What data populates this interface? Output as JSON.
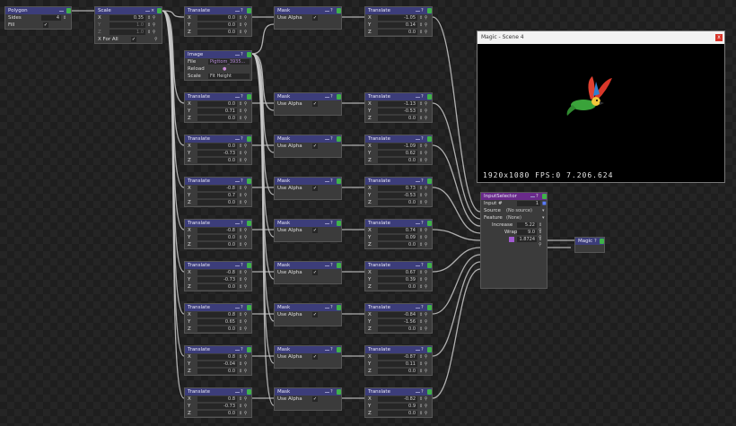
{
  "polygon": {
    "title": "Polygon",
    "sides_label": "Sides",
    "sides_value": "4",
    "fill_label": "Fill"
  },
  "scale": {
    "title": "Scale",
    "x": "0.35",
    "y": "1.0",
    "z": "1.0",
    "xforall": "X For All"
  },
  "image": {
    "title": "Image",
    "file_label": "File",
    "file_value": "Pigttom_3935...",
    "reload_label": "Reload",
    "scale_label": "Scale",
    "scale_value": "Fit Height"
  },
  "mask": {
    "title": "Mask",
    "use_alpha": "Use Alpha"
  },
  "translate_title": "Translate",
  "translate_left": [
    {
      "x": "0.0",
      "y": "0.0",
      "z": "0.0"
    },
    {
      "x": "0.0",
      "y": "0.71",
      "z": "0.0"
    },
    {
      "x": "0.0",
      "y": "-0.73",
      "z": "0.0"
    },
    {
      "x": "-0.8",
      "y": "0.7",
      "z": "0.0"
    },
    {
      "x": "-0.8",
      "y": "0.0",
      "z": "0.0"
    },
    {
      "x": "-0.8",
      "y": "-0.73",
      "z": "0.0"
    },
    {
      "x": "0.8",
      "y": "0.65",
      "z": "0.0"
    },
    {
      "x": "0.8",
      "y": "-0.04",
      "z": "0.0"
    },
    {
      "x": "0.8",
      "y": "-0.73",
      "z": "0.0"
    }
  ],
  "translate_right": [
    {
      "x": "-1.05",
      "y": "0.14",
      "z": "0.0"
    },
    {
      "x": "-1.13",
      "y": "-0.53",
      "z": "0.0"
    },
    {
      "x": "-1.09",
      "y": "0.62",
      "z": "0.0"
    },
    {
      "x": "0.73",
      "y": "-0.53",
      "z": "0.0"
    },
    {
      "x": "0.74",
      "y": "0.09",
      "z": "0.0"
    },
    {
      "x": "0.67",
      "y": "0.39",
      "z": "0.0"
    },
    {
      "x": "-0.84",
      "y": "-1.56",
      "z": "0.0"
    },
    {
      "x": "-0.87",
      "y": "0.11",
      "z": "0.0"
    },
    {
      "x": "-0.82",
      "y": "0.9",
      "z": "0.0"
    }
  ],
  "preview": {
    "title": "Magic - Scene 4",
    "status": "1920x1080 FPS:0 7.206.624",
    "close": "x"
  },
  "input_selector": {
    "title": "InputSelector",
    "input_label": "Input #",
    "input_value": "1",
    "source_label": "Source",
    "source_value": "(No source)",
    "feature_label": "Feature",
    "feature_value": "(None)",
    "increase_label": "Increase",
    "increase_value": "5.22",
    "wrap_label": "Wrap",
    "wrap_value": "9.0",
    "extra_value": "1.8724"
  },
  "magic": {
    "title": "Magic"
  },
  "colors": {
    "header": "#3c3d7a",
    "header_magenta": "#6a2a8a",
    "node_bg": "#3b3b3b",
    "wire": "#c8c8c8",
    "green_button": "#3fb24a"
  }
}
